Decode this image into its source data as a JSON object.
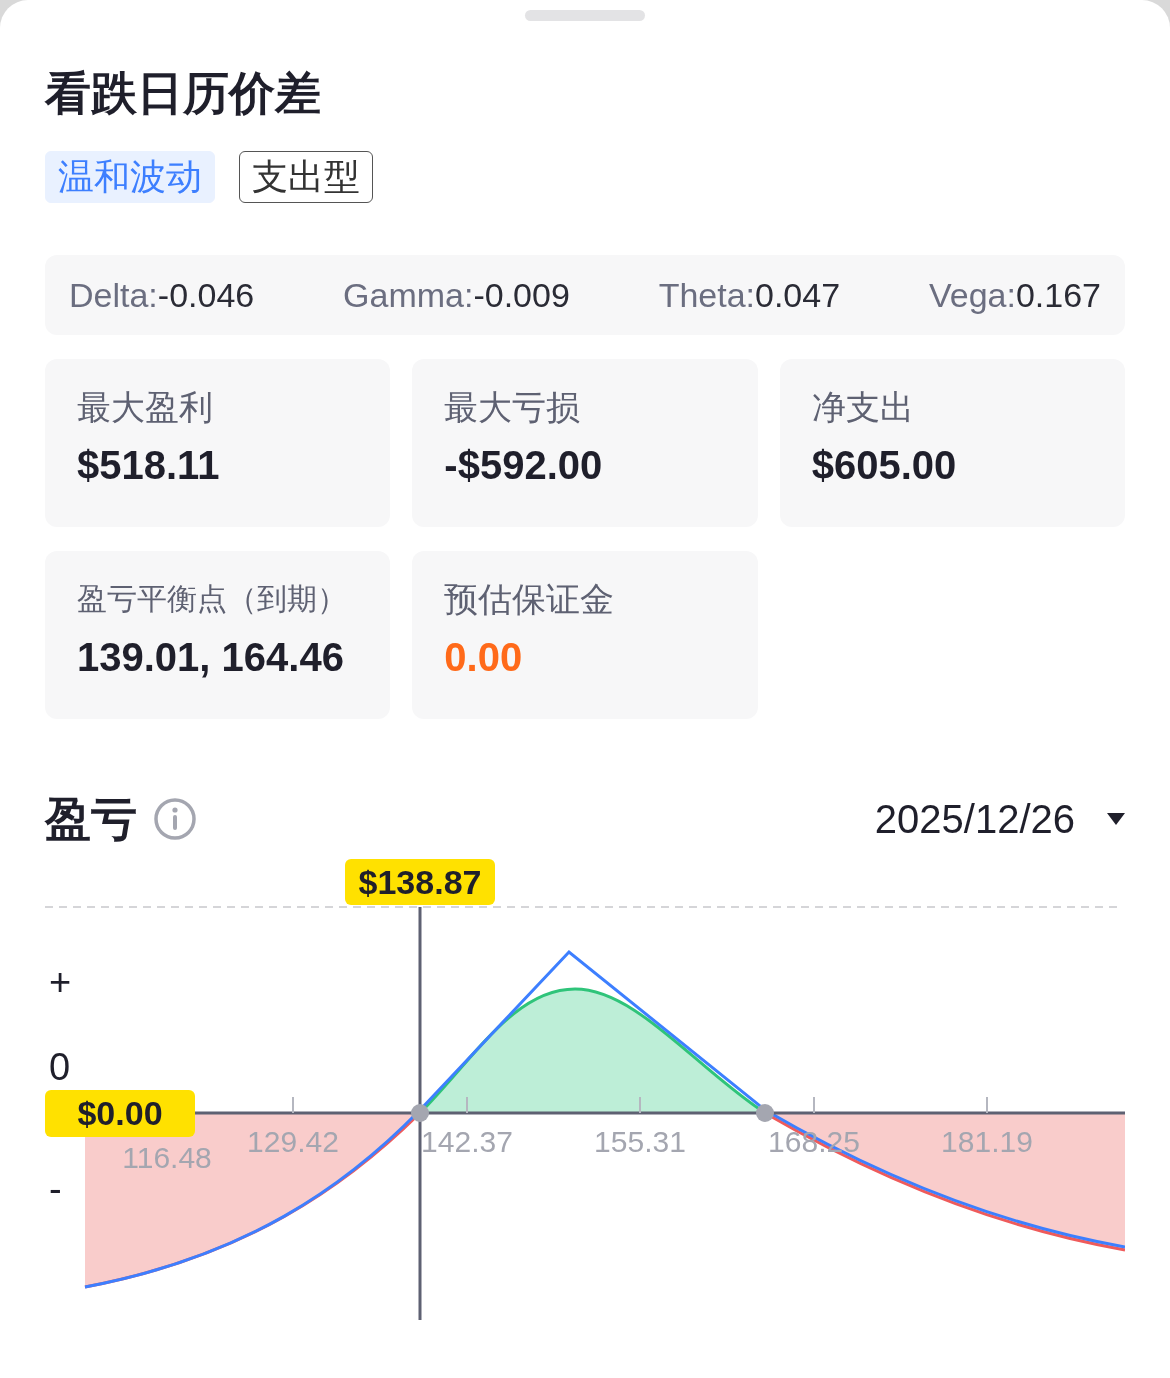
{
  "title": "看跌日历价差",
  "tags": [
    {
      "label": "温和波动",
      "kind": "filled"
    },
    {
      "label": "支出型",
      "kind": "outlined"
    }
  ],
  "greeks": [
    {
      "label": "Delta:",
      "value": "-0.046"
    },
    {
      "label": "Gamma:",
      "value": "-0.009"
    },
    {
      "label": "Theta:",
      "value": "0.047"
    },
    {
      "label": "Vega:",
      "value": "0.167"
    }
  ],
  "stats": [
    {
      "label": "最大盈利",
      "value": "$518.11",
      "highlighted": false,
      "small": false
    },
    {
      "label": "最大亏损",
      "value": "-$592.00",
      "highlighted": false,
      "small": false
    },
    {
      "label": "净支出",
      "value": "$605.00",
      "highlighted": false,
      "small": false
    },
    {
      "label": "盈亏平衡点（到期）",
      "value": "139.01, 164.46",
      "highlighted": false,
      "small": true
    },
    {
      "label": "预估保证金",
      "value": "0.00",
      "highlighted": true,
      "small": false
    }
  ],
  "pnl": {
    "title": "盈亏",
    "date": "2025/12/26",
    "price_marker": "$138.87",
    "zero_marker": "$0.00",
    "y_labels": [
      "+",
      "0",
      "-"
    ],
    "x_labels": [
      "116.48",
      "129.42",
      "142.37",
      "155.31",
      "168.25",
      "181.19"
    ]
  }
}
